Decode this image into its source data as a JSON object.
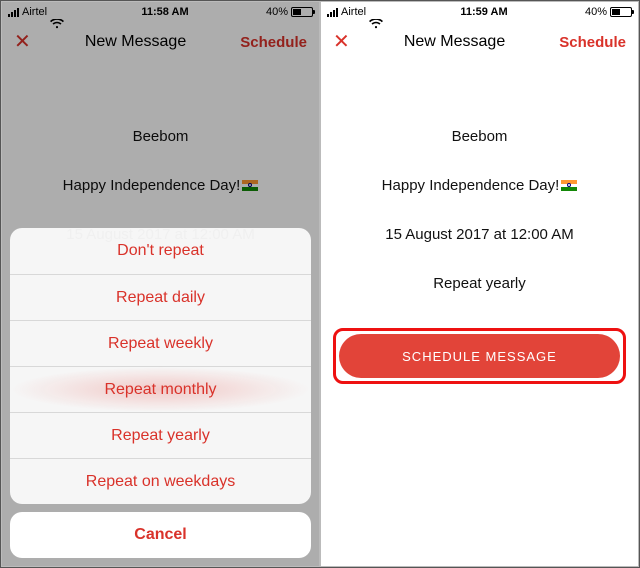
{
  "left": {
    "status": {
      "carrier": "Airtel",
      "time": "11:58 AM",
      "battery": "40%"
    },
    "nav": {
      "title": "New Message",
      "action": "Schedule"
    },
    "rows": {
      "to": "Beebom",
      "message": "Happy Independence Day!",
      "datetime": "15 August 2017 at 12:00 AM"
    },
    "sheet": {
      "options": {
        "dont_repeat": "Don't repeat",
        "daily": "Repeat daily",
        "weekly": "Repeat weekly",
        "monthly": "Repeat monthly",
        "yearly": "Repeat yearly",
        "weekdays": "Repeat on weekdays"
      },
      "cancel": "Cancel"
    }
  },
  "right": {
    "status": {
      "carrier": "Airtel",
      "time": "11:59 AM",
      "battery": "40%"
    },
    "nav": {
      "title": "New Message",
      "action": "Schedule"
    },
    "rows": {
      "to": "Beebom",
      "message": "Happy Independence Day!",
      "datetime": "15 August 2017 at 12:00 AM",
      "repeat": "Repeat yearly"
    },
    "cta": "SCHEDULE MESSAGE"
  }
}
